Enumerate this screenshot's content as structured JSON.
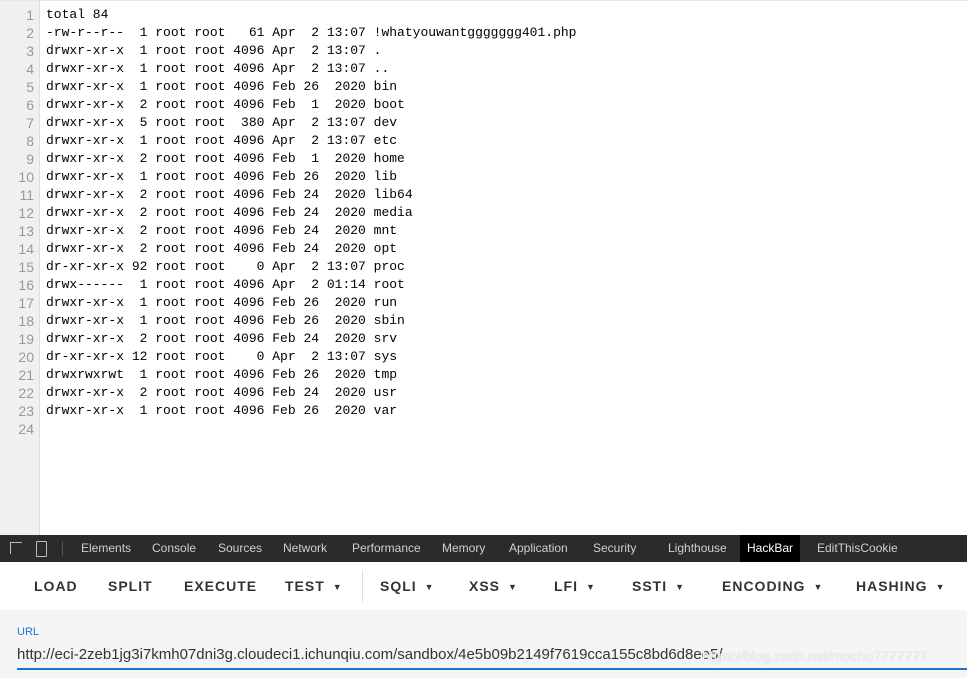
{
  "viewer": {
    "lines": [
      "total 84",
      "-rw-r--r--  1 root root   61 Apr  2 13:07 !whatyouwantggggggg401.php",
      "drwxr-xr-x  1 root root 4096 Apr  2 13:07 .",
      "drwxr-xr-x  1 root root 4096 Apr  2 13:07 ..",
      "drwxr-xr-x  1 root root 4096 Feb 26  2020 bin",
      "drwxr-xr-x  2 root root 4096 Feb  1  2020 boot",
      "drwxr-xr-x  5 root root  380 Apr  2 13:07 dev",
      "drwxr-xr-x  1 root root 4096 Apr  2 13:07 etc",
      "drwxr-xr-x  2 root root 4096 Feb  1  2020 home",
      "drwxr-xr-x  1 root root 4096 Feb 26  2020 lib",
      "drwxr-xr-x  2 root root 4096 Feb 24  2020 lib64",
      "drwxr-xr-x  2 root root 4096 Feb 24  2020 media",
      "drwxr-xr-x  2 root root 4096 Feb 24  2020 mnt",
      "drwxr-xr-x  2 root root 4096 Feb 24  2020 opt",
      "dr-xr-xr-x 92 root root    0 Apr  2 13:07 proc",
      "drwx------  1 root root 4096 Apr  2 01:14 root",
      "drwxr-xr-x  1 root root 4096 Feb 26  2020 run",
      "drwxr-xr-x  1 root root 4096 Feb 26  2020 sbin",
      "drwxr-xr-x  2 root root 4096 Feb 24  2020 srv",
      "dr-xr-xr-x 12 root root    0 Apr  2 13:07 sys",
      "drwxrwxrwt  1 root root 4096 Feb 26  2020 tmp",
      "drwxr-xr-x  2 root root 4096 Feb 24  2020 usr",
      "drwxr-xr-x  1 root root 4096 Feb 26  2020 var",
      ""
    ]
  },
  "devtools": {
    "icons": [
      "inspect-element-icon",
      "device-toolbar-icon"
    ],
    "tabs": [
      "Elements",
      "Console",
      "Sources",
      "Network",
      "Performance",
      "Memory",
      "Application",
      "Security",
      "Lighthouse",
      "HackBar",
      "EditThisCookie"
    ],
    "active_tab": "HackBar"
  },
  "hackbar": {
    "buttons": [
      {
        "label": "LOAD",
        "dropdown": false
      },
      {
        "label": "SPLIT",
        "dropdown": false
      },
      {
        "label": "EXECUTE",
        "dropdown": false
      },
      {
        "label": "TEST",
        "dropdown": true
      },
      {
        "label": "SQLI",
        "dropdown": true
      },
      {
        "label": "XSS",
        "dropdown": true
      },
      {
        "label": "LFI",
        "dropdown": true
      },
      {
        "label": "SSTI",
        "dropdown": true
      },
      {
        "label": "ENCODING",
        "dropdown": true
      },
      {
        "label": "HASHING",
        "dropdown": true
      }
    ],
    "url_label": "URL",
    "url_value": "http://eci-2zeb1jg3i7kmh07dni3g.cloudeci1.ichunqiu.com/sandbox/4e5b09b2149f7619cca155c8bd6d8ee5/",
    "accent": "#1976d2"
  },
  "watermark": "https://blog.csdn.net/mochu7777777"
}
